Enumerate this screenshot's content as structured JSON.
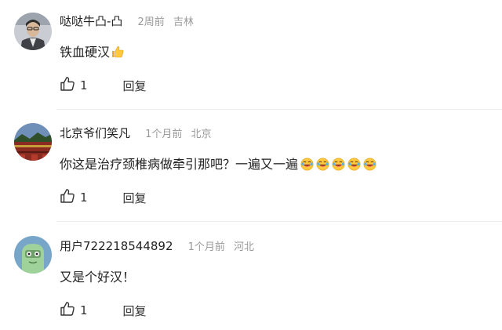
{
  "comments": [
    {
      "username": "哒哒牛凸-凸",
      "time": "2周前",
      "location": "吉林",
      "content": "铁血硬汉",
      "emoji": "thumbs-up",
      "likes": "1",
      "reply_label": "回复"
    },
    {
      "username": "北京爷们笑凡",
      "time": "1个月前",
      "location": "北京",
      "content": "你这是治疗颈椎病做牵引那吧？一遍又一遍",
      "emoji": "laugh-cry-face",
      "likes": "1",
      "reply_label": "回复"
    },
    {
      "username": "用户722218544892",
      "time": "1个月前",
      "location": "河北",
      "content": "又是个好汉！",
      "likes": "1",
      "reply_label": "回复"
    }
  ],
  "colors": {
    "text": "#222222",
    "muted": "#999999",
    "divider": "#ececec",
    "emoji_yellow": "#FFC83D"
  }
}
